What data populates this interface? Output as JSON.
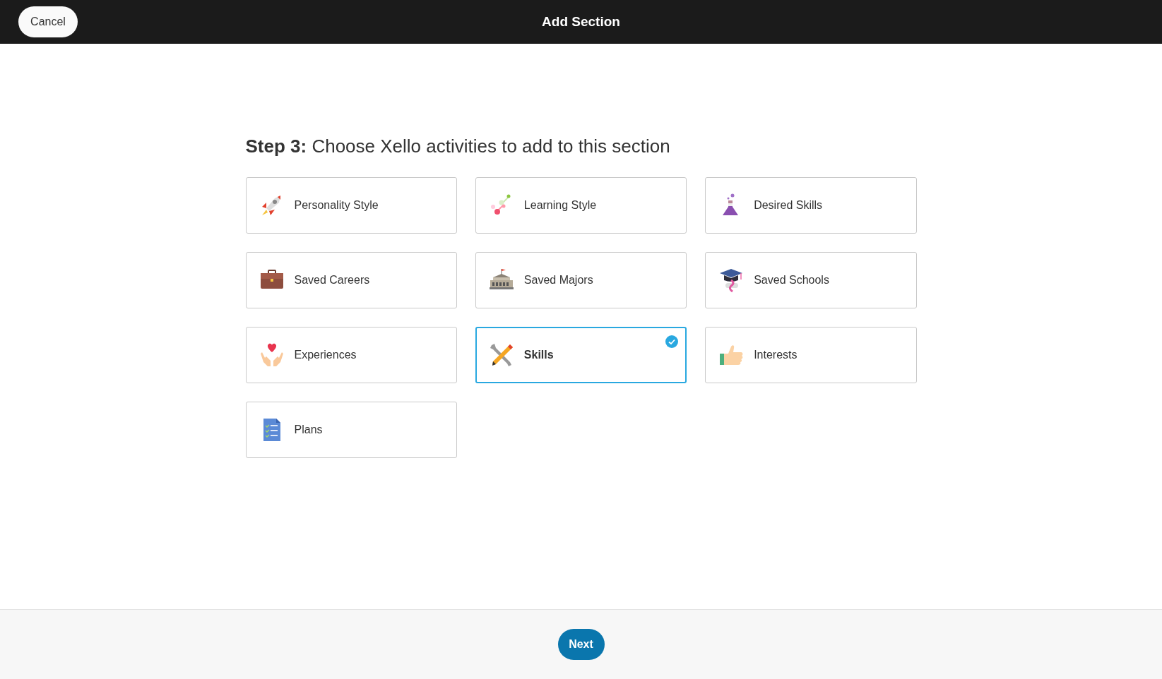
{
  "header": {
    "cancel_button": "Cancel",
    "title": "Add Section"
  },
  "heading": {
    "step": "Step 3:",
    "text": "Choose Xello activities to add to this section"
  },
  "activities": [
    {
      "kind": "rocket",
      "label": "Personality Style",
      "selected": false
    },
    {
      "kind": "nodes",
      "label": "Learning Style",
      "selected": false
    },
    {
      "kind": "flask",
      "label": "Desired Skills",
      "selected": false
    },
    {
      "kind": "briefcase",
      "label": "Saved Careers",
      "selected": false
    },
    {
      "kind": "building",
      "label": "Saved Majors",
      "selected": false
    },
    {
      "kind": "gradcap",
      "label": "Saved Schools",
      "selected": false
    },
    {
      "kind": "hands",
      "label": "Experiences",
      "selected": false
    },
    {
      "kind": "tools",
      "label": "Skills",
      "selected": true
    },
    {
      "kind": "thumb",
      "label": "Interests",
      "selected": false
    },
    {
      "kind": "document",
      "label": "Plans",
      "selected": false
    }
  ],
  "footer": {
    "next_button": "Next"
  }
}
